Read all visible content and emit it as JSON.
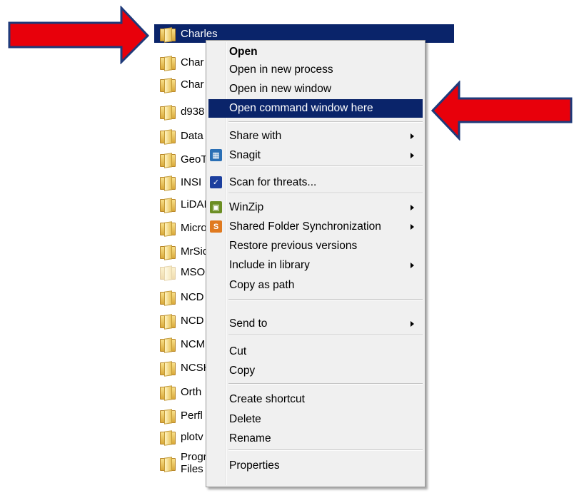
{
  "file_list": [
    {
      "name": "Charles",
      "selected": true
    },
    {
      "name": "Char"
    },
    {
      "name": "Char"
    },
    {
      "name": "d938"
    },
    {
      "name": "Data"
    },
    {
      "name": "GeoT"
    },
    {
      "name": "INSI"
    },
    {
      "name": "LiDAI"
    },
    {
      "name": "Micro"
    },
    {
      "name": "MrSid"
    },
    {
      "name": "MSO",
      "faded": true
    },
    {
      "name": "NCD"
    },
    {
      "name": "NCD"
    },
    {
      "name": "NCM"
    },
    {
      "name": "NCSH"
    },
    {
      "name": "Orth"
    },
    {
      "name": "Perfl"
    },
    {
      "name": "plotv"
    },
    {
      "name": "Program Files"
    }
  ],
  "context_menu": {
    "items": [
      {
        "id": "open",
        "label": "Open",
        "bold": true
      },
      {
        "id": "open-new-process",
        "label": "Open in new process"
      },
      {
        "id": "open-new-window",
        "label": "Open in new window"
      },
      {
        "id": "open-command-window",
        "label": "Open command window here",
        "highlighted": true
      },
      {
        "separator": true
      },
      {
        "id": "share-with",
        "label": "Share with",
        "submenu": true
      },
      {
        "id": "snagit",
        "label": "Snagit",
        "submenu": true,
        "icon": "snagit-icon"
      },
      {
        "separator": true
      },
      {
        "id": "scan-threats",
        "label": "Scan for threats...",
        "icon": "shield-icon"
      },
      {
        "separator": true
      },
      {
        "id": "winzip",
        "label": "WinZip",
        "submenu": true,
        "icon": "winzip-icon"
      },
      {
        "id": "shared-folder-sync",
        "label": "Shared Folder Synchronization",
        "submenu": true,
        "icon": "sync-icon"
      },
      {
        "id": "restore-versions",
        "label": "Restore previous versions"
      },
      {
        "id": "include-library",
        "label": "Include in library",
        "submenu": true
      },
      {
        "id": "copy-as-path",
        "label": "Copy as path"
      },
      {
        "separator": true
      },
      {
        "id": "send-to",
        "label": "Send to",
        "submenu": true
      },
      {
        "separator": true
      },
      {
        "id": "cut",
        "label": "Cut"
      },
      {
        "id": "copy",
        "label": "Copy"
      },
      {
        "separator": true
      },
      {
        "id": "create-shortcut",
        "label": "Create shortcut"
      },
      {
        "id": "delete",
        "label": "Delete"
      },
      {
        "id": "rename",
        "label": "Rename"
      },
      {
        "separator": true
      },
      {
        "id": "properties",
        "label": "Properties"
      }
    ]
  },
  "colors": {
    "selection": "#0a246a",
    "arrow_fill": "#e8000b",
    "arrow_stroke": "#1f3a7a"
  }
}
